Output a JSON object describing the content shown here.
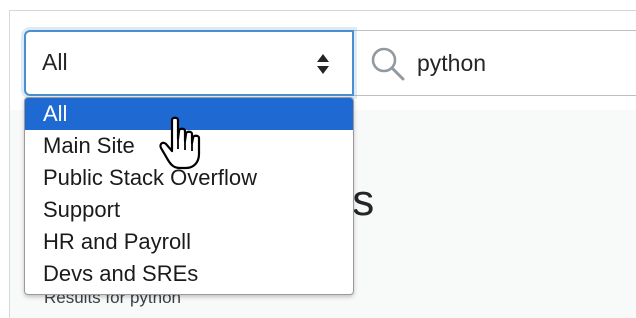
{
  "scope_select": {
    "value": "All",
    "icon": "sort-arrows-icon"
  },
  "search": {
    "icon": "search-icon",
    "value": "python"
  },
  "dropdown": {
    "options": [
      {
        "label": "All",
        "selected": true
      },
      {
        "label": "Main Site",
        "selected": false
      },
      {
        "label": "Public Stack Overflow",
        "selected": false
      },
      {
        "label": "Support",
        "selected": false
      },
      {
        "label": "HR and Payroll",
        "selected": false
      },
      {
        "label": "Devs and SREs",
        "selected": false
      }
    ]
  },
  "page": {
    "title_partial": "ts",
    "results_for": "Results for python"
  },
  "cursor": "hand-pointer-icon",
  "colors": {
    "focus_border": "#4b8fcc",
    "selected_option": "#1f69d3",
    "text": "#232629"
  }
}
